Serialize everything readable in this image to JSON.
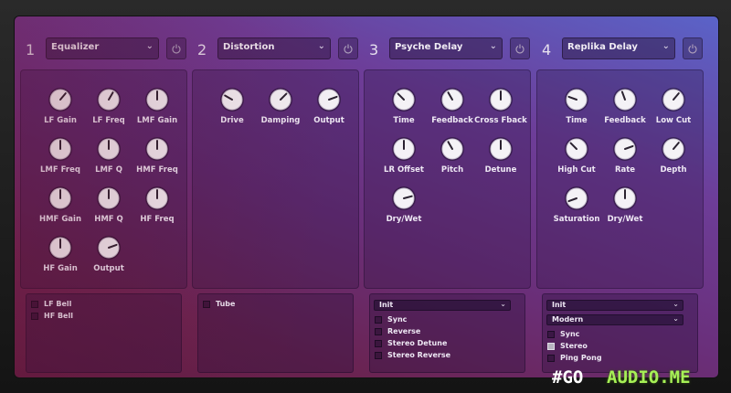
{
  "slots": [
    {
      "number": "1",
      "effect": "Equalizer",
      "knobs": [
        {
          "label": "LF Gain",
          "angle": 40
        },
        {
          "label": "LF Freq",
          "angle": 30
        },
        {
          "label": "LMF Gain",
          "angle": 0
        },
        {
          "label": "LMF Freq",
          "angle": 0
        },
        {
          "label": "LMF Q",
          "angle": 0
        },
        {
          "label": "HMF Freq",
          "angle": 0
        },
        {
          "label": "HMF Gain",
          "angle": 0
        },
        {
          "label": "HMF Q",
          "angle": 0
        },
        {
          "label": "HF Freq",
          "angle": 0
        },
        {
          "label": "HF Gain",
          "angle": 0
        },
        {
          "label": "Output",
          "angle": 70
        }
      ],
      "checkboxes": [
        {
          "label": "LF Bell",
          "checked": false
        },
        {
          "label": "HF Bell",
          "checked": false
        }
      ],
      "dropdowns": []
    },
    {
      "number": "2",
      "effect": "Distortion",
      "knobs": [
        {
          "label": "Drive",
          "angle": -60
        },
        {
          "label": "Damping",
          "angle": 45
        },
        {
          "label": "Output",
          "angle": 70
        }
      ],
      "checkboxes": [
        {
          "label": "Tube",
          "checked": false
        }
      ],
      "dropdowns": []
    },
    {
      "number": "3",
      "effect": "Psyche Delay",
      "knobs": [
        {
          "label": "Time",
          "angle": -45
        },
        {
          "label": "Feedback",
          "angle": -30
        },
        {
          "label": "Cross Fback",
          "angle": 0
        },
        {
          "label": "LR Offset",
          "angle": 0
        },
        {
          "label": "Pitch",
          "angle": -30
        },
        {
          "label": "Detune",
          "angle": 0
        },
        {
          "label": "Dry/Wet",
          "angle": 75
        }
      ],
      "checkboxes": [
        {
          "label": "Sync",
          "checked": false
        },
        {
          "label": "Reverse",
          "checked": false
        },
        {
          "label": "Stereo Detune",
          "checked": false
        },
        {
          "label": "Stereo Reverse",
          "checked": false
        }
      ],
      "dropdowns": [
        {
          "value": "Init"
        }
      ]
    },
    {
      "number": "4",
      "effect": "Replika Delay",
      "knobs": [
        {
          "label": "Time",
          "angle": -70
        },
        {
          "label": "Feedback",
          "angle": -20
        },
        {
          "label": "Low Cut",
          "angle": 40
        },
        {
          "label": "High Cut",
          "angle": -45
        },
        {
          "label": "Rate",
          "angle": 70
        },
        {
          "label": "Depth",
          "angle": 40
        },
        {
          "label": "Saturation",
          "angle": -110
        },
        {
          "label": "Dry/Wet",
          "angle": 0
        }
      ],
      "checkboxes": [
        {
          "label": "Sync",
          "checked": false
        },
        {
          "label": "Stereo",
          "checked": true
        },
        {
          "label": "Ping Pong",
          "checked": false
        }
      ],
      "dropdowns": [
        {
          "value": "Init"
        },
        {
          "value": "Modern"
        }
      ]
    }
  ],
  "watermark": {
    "part1": "#GO",
    "part2": "AUDIO.ME"
  }
}
